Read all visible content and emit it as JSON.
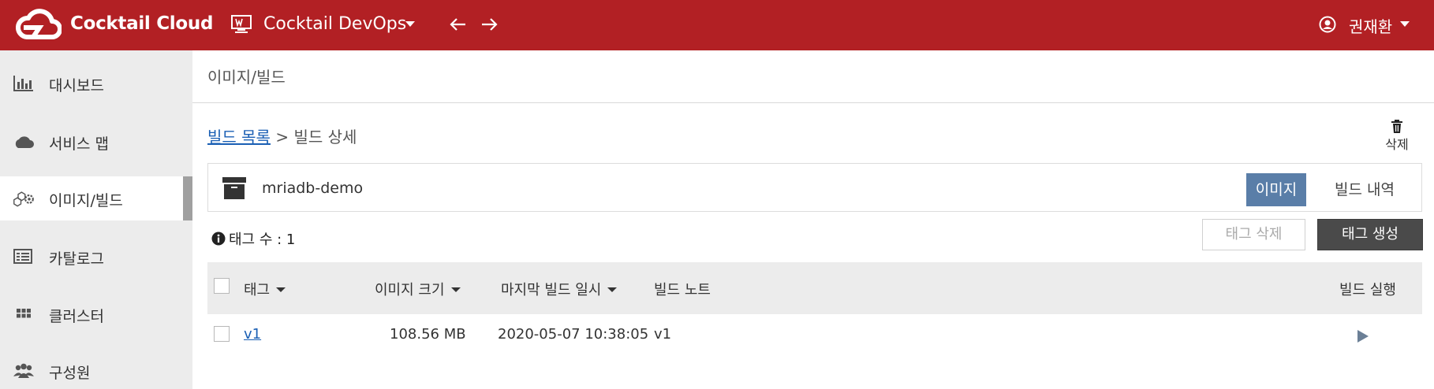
{
  "header": {
    "brand": "Cocktail Cloud",
    "workspace": "Cocktail DevOps",
    "user_name": "권재환",
    "accent_color": "#b22024",
    "icons": [
      "cloud-logo-icon",
      "workspace-icon",
      "arrow-left-icon",
      "arrow-right-icon",
      "user-icon"
    ]
  },
  "sidebar": {
    "items": [
      {
        "label": "대시보드",
        "icon": "bar-chart-icon"
      },
      {
        "label": "서비스 맵",
        "icon": "cloud-icon"
      },
      {
        "label": "이미지/빌드",
        "icon": "cubes-gear-icon",
        "active": true
      },
      {
        "label": "카탈로그",
        "icon": "list-card-icon"
      },
      {
        "label": "클러스터",
        "icon": "grid-icon"
      },
      {
        "label": "구성원",
        "icon": "users-icon"
      }
    ]
  },
  "page": {
    "title": "이미지/빌드",
    "breadcrumb": {
      "link": "빌드 목록",
      "separator": ">",
      "current": "빌드 상세"
    },
    "delete_label": "삭제"
  },
  "build": {
    "name": "mriadb-demo",
    "tabs": {
      "image": "이미지",
      "history": "빌드 내역"
    },
    "active_tab_color": "#5a7ea8"
  },
  "tags": {
    "count_label": "태그 수 : 1",
    "delete_button": "태그 삭제",
    "create_button": "태그 생성"
  },
  "table": {
    "columns": {
      "tag": "태그",
      "size": "이미지 크기",
      "last_build": "마지막 빌드 일시",
      "note": "빌드 노트",
      "run": "빌드 실행"
    },
    "rows": [
      {
        "tag": "v1",
        "size": "108.56 MB",
        "last_build": "2020-05-07 10:38:05",
        "note": "v1"
      }
    ]
  }
}
